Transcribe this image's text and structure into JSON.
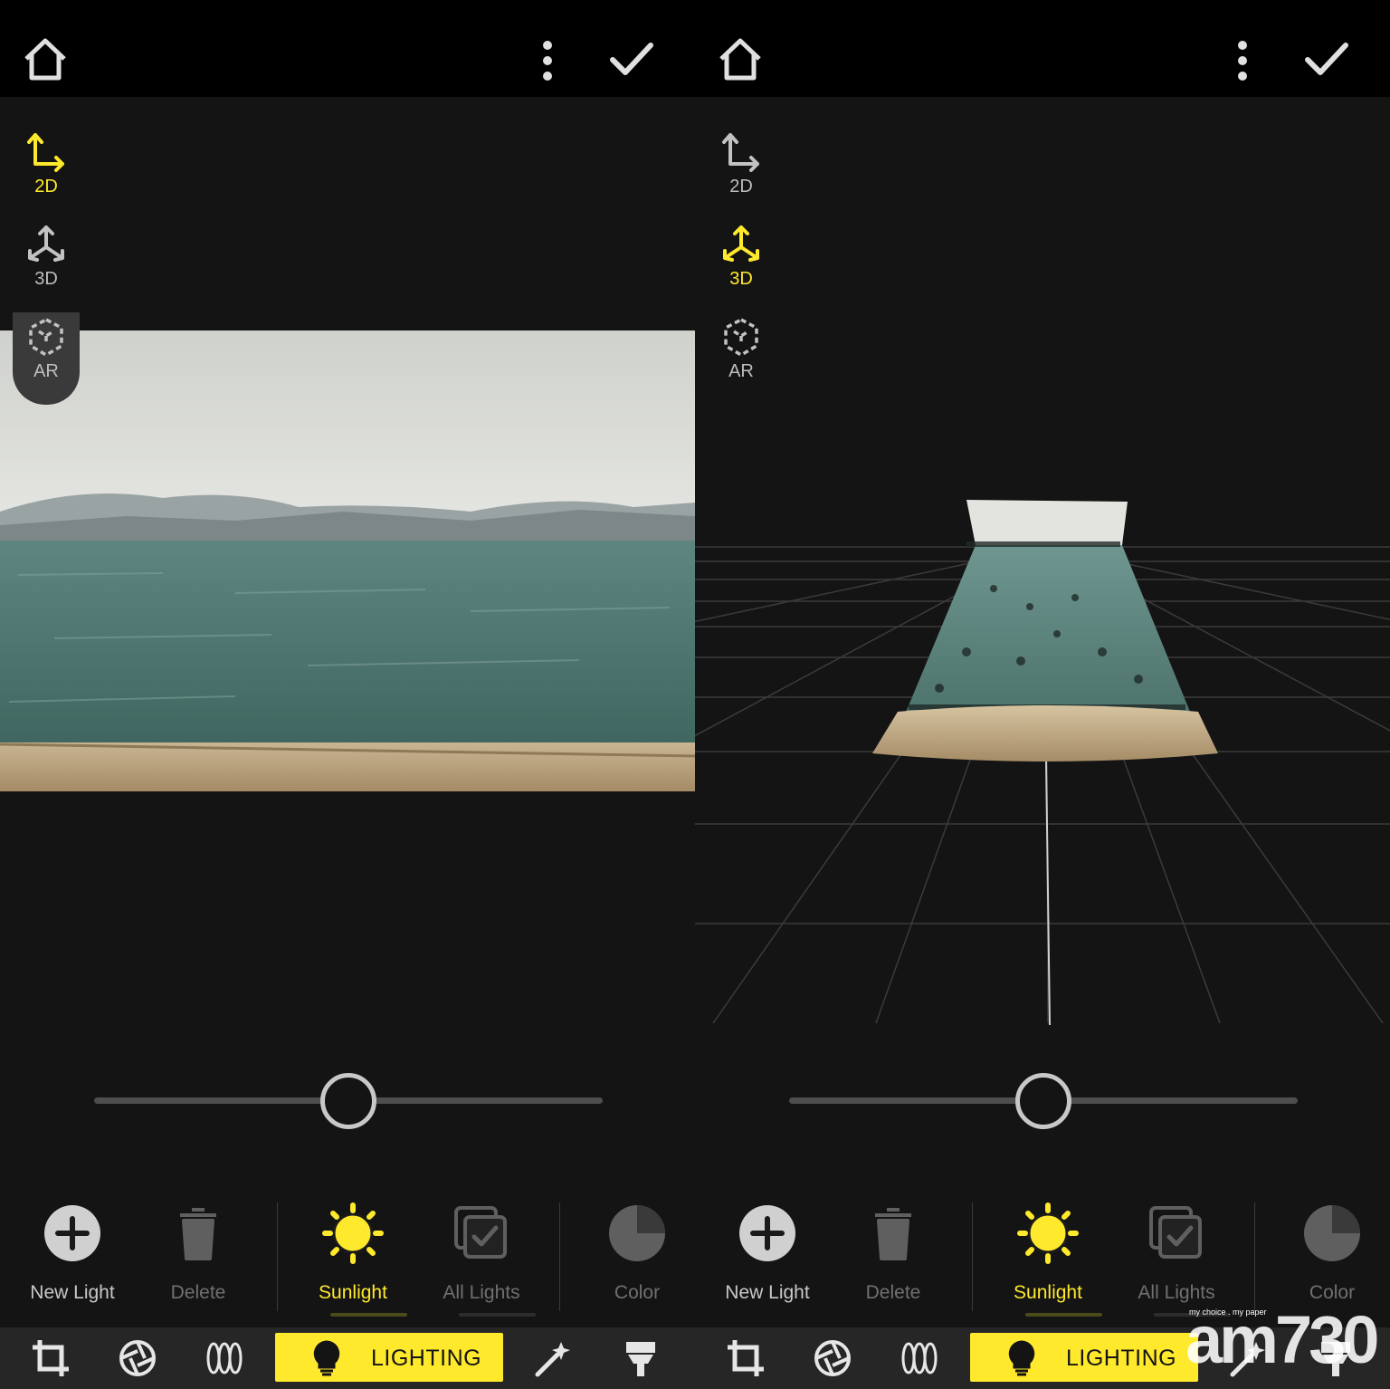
{
  "colors": {
    "accent": "#ffe92c",
    "background": "#141414",
    "topbar": "#000000",
    "toolbar": "#262626"
  },
  "panels": [
    {
      "id": "left",
      "active_mode": "2D",
      "modes": [
        {
          "label": "2D",
          "icon": "axes-2d-icon"
        },
        {
          "label": "3D",
          "icon": "axes-3d-icon"
        },
        {
          "label": "AR",
          "icon": "ar-cube-icon"
        }
      ],
      "slider": {
        "value": 0.5
      },
      "tools": [
        {
          "label": "New Light",
          "icon": "plus-circle-icon"
        },
        {
          "label": "Delete",
          "icon": "trash-icon"
        },
        {
          "label": "Sunlight",
          "icon": "sun-icon"
        },
        {
          "label": "All Lights",
          "icon": "select-all-icon"
        },
        {
          "label": "Color",
          "icon": "pie-color-icon"
        }
      ],
      "bottom_tab": {
        "label": "LIGHTING",
        "icon": "lightbulb-icon"
      }
    },
    {
      "id": "right",
      "active_mode": "3D",
      "modes": [
        {
          "label": "2D",
          "icon": "axes-2d-icon"
        },
        {
          "label": "3D",
          "icon": "axes-3d-icon"
        },
        {
          "label": "AR",
          "icon": "ar-cube-icon"
        }
      ],
      "slider": {
        "value": 0.5
      },
      "tools": [
        {
          "label": "New Light",
          "icon": "plus-circle-icon"
        },
        {
          "label": "Delete",
          "icon": "trash-icon"
        },
        {
          "label": "Sunlight",
          "icon": "sun-icon"
        },
        {
          "label": "All Lights",
          "icon": "select-all-icon"
        },
        {
          "label": "Color",
          "icon": "pie-color-icon"
        }
      ],
      "bottom_tab": {
        "label": "LIGHTING",
        "icon": "lightbulb-icon"
      }
    }
  ],
  "watermark": {
    "text": "am730",
    "tagline": "my choice . my paper"
  }
}
